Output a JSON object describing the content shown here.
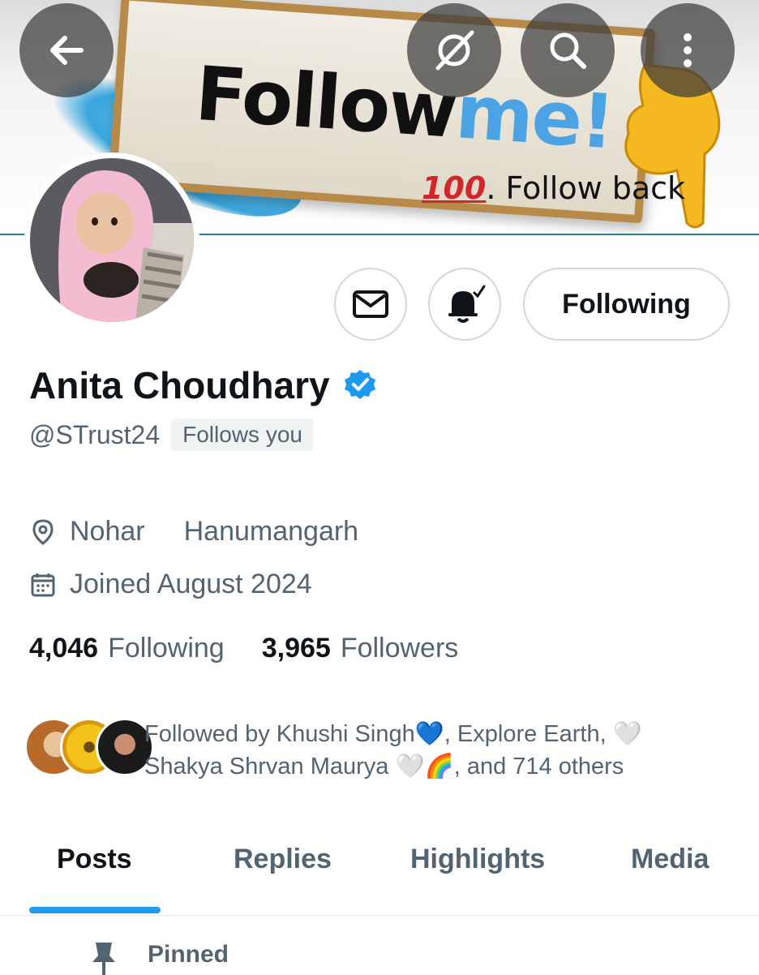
{
  "banner": {
    "sign_text_a": "Follow",
    "sign_text_b": "me!",
    "follow_back_emoji": "100",
    "follow_back_text": ". Follow back"
  },
  "header_icons": [
    "back-arrow-icon",
    "grok-icon",
    "search-icon",
    "more-vertical-icon"
  ],
  "actions": {
    "message_icon": "mail-icon",
    "notify_icon": "bell-check-icon",
    "following_label": "Following"
  },
  "profile": {
    "name": "Anita Choudhary",
    "handle": "@STrust24",
    "follows_you": "Follows you",
    "location_a": "Nohar",
    "location_b": "Hanumangarh",
    "joined": "Joined August 2024",
    "following_count": "4,046",
    "following_label": "Following",
    "followers_count": "3,965",
    "followers_label": "Followers",
    "followed_by_line1": "Followed by Khushi Singh💙, Explore Earth, 🤍",
    "followed_by_line2": "Shakya Shrvan Maurya 🤍🌈, and 714 others"
  },
  "tabs": [
    {
      "label": "Posts",
      "active": true
    },
    {
      "label": "Replies",
      "active": false
    },
    {
      "label": "Highlights",
      "active": false
    },
    {
      "label": "Media",
      "active": false
    }
  ],
  "pinned": {
    "label": "Pinned"
  },
  "colors": {
    "accent": "#1d9bf0",
    "text_primary": "#0f1419",
    "text_secondary": "#536471",
    "border": "#cfd9de",
    "banner_line": "#2b7e8c"
  }
}
